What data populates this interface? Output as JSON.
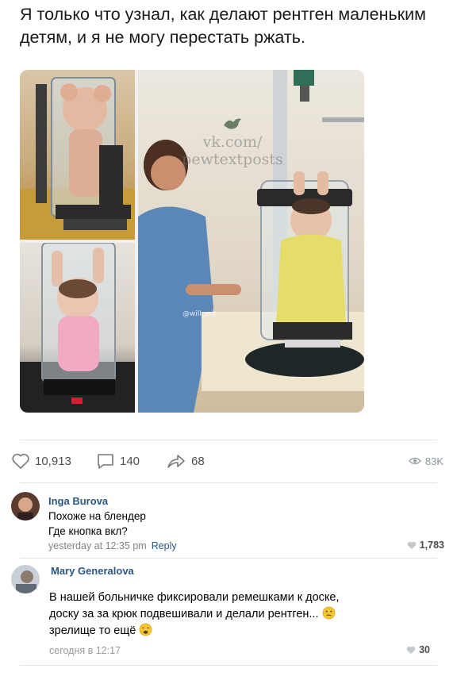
{
  "post": {
    "text": "Я только что узнал, как делают рентген маленьким детям, и я не могу перестать ржать.",
    "watermark_line1": "vk.com/",
    "watermark_line2": "pewtextposts",
    "photo_credit": "@will_ent"
  },
  "actions": {
    "likes": "10,913",
    "comments": "140",
    "shares": "68",
    "views": "83K"
  },
  "comments": [
    {
      "author": "Inga Burova",
      "line1": "Похоже на блендер",
      "line2": "Где кнопка вкл?",
      "time": "yesterday at 12:35 pm",
      "reply_label": "Reply",
      "likes": "1,783"
    },
    {
      "author": "Mary Generalova",
      "line1": "В нашей больничке фиксировали ремешками к доске,",
      "line2": "доску за за крюк подвешивали и делали рентген...",
      "line3": "зрелище то ещё",
      "time": "сегодня в 12:17",
      "likes": "30"
    }
  ],
  "colors": {
    "link": "#2a5885",
    "meta": "#828282",
    "divider": "#e3e4e8"
  },
  "icons": [
    "heart-icon",
    "comment-icon",
    "share-icon",
    "eye-icon",
    "small-heart-icon",
    "vk-bird-icon"
  ]
}
